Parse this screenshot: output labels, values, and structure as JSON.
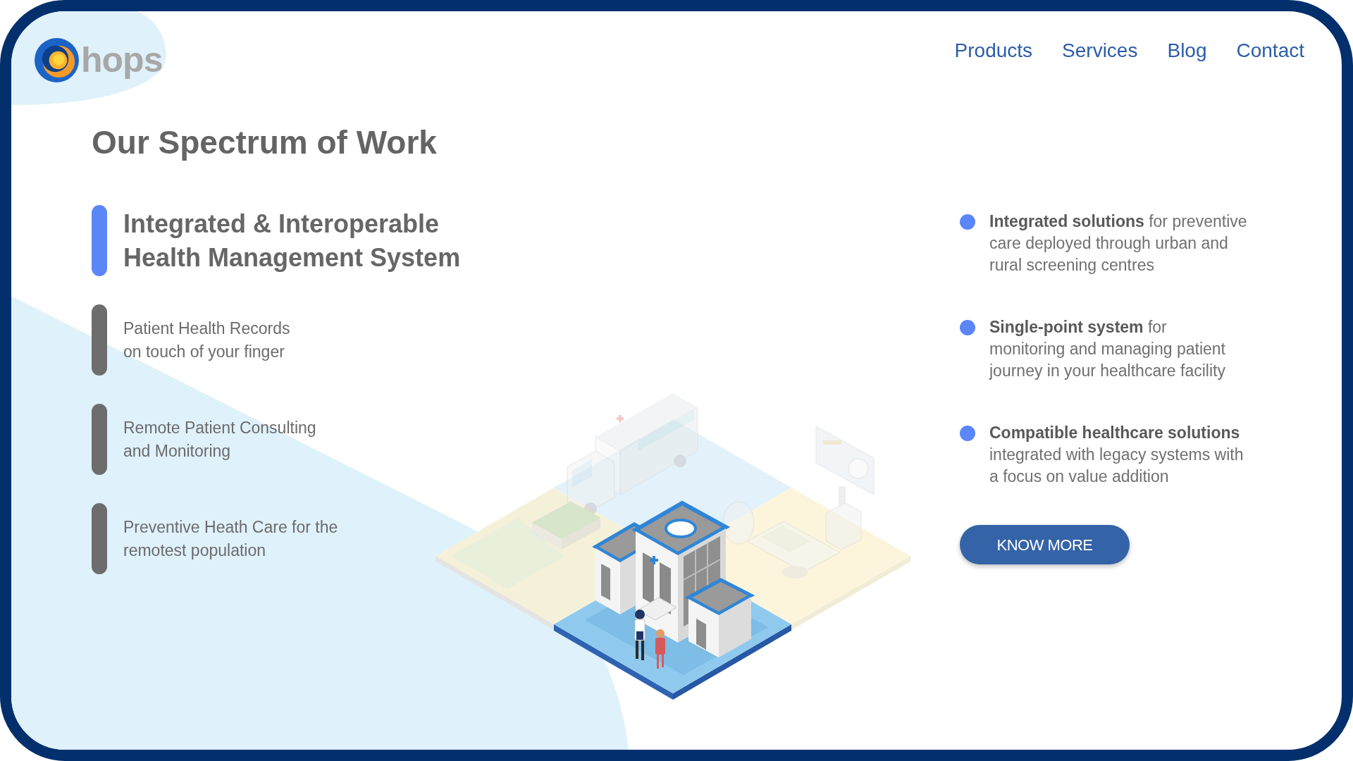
{
  "logo": {
    "text": "hops"
  },
  "nav": [
    {
      "label": "Products"
    },
    {
      "label": "Services"
    },
    {
      "label": "Blog"
    },
    {
      "label": "Contact"
    }
  ],
  "heading": "Our Spectrum of Work",
  "features": [
    {
      "text": "Integrated & Interoperable\nHealth Management System",
      "selected": true
    },
    {
      "text": "Patient Health Records\non touch of your finger",
      "selected": false
    },
    {
      "text": "Remote Patient Consulting\nand Monitoring",
      "selected": false
    },
    {
      "text": "Preventive Heath Care for the\nremotest population",
      "selected": false
    }
  ],
  "highlights": [
    {
      "text": "**Integrated solutions** for preventive\ncare deployed through urban and\nrural screening centres"
    },
    {
      "text": "**Single-point system** for\nmonitoring and managing patient\njourney in your healthcare facility"
    },
    {
      "text": "**Compatible healthcare solutions**\nintegrated with legacy systems with\na focus on value addition"
    }
  ],
  "button": {
    "label": "KNOW MORE"
  }
}
